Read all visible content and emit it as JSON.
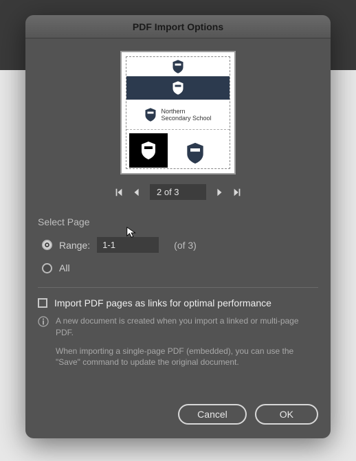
{
  "dialog": {
    "title": "PDF Import Options"
  },
  "preview": {
    "school_line1": "Northern",
    "school_line2": "Secondary School"
  },
  "pager": {
    "current": "2 of 3"
  },
  "select_page": {
    "label": "Select Page",
    "range_label": "Range:",
    "range_value": "1-1",
    "total_label": "(of 3)",
    "all_label": "All"
  },
  "import_links": {
    "checkbox_label": "Import PDF pages as links for optimal performance",
    "info_p1": "A new document is created when you import a linked or multi-page PDF.",
    "info_p2": "When importing a single-page PDF (embedded), you can use the \"Save\" command to update the original document."
  },
  "buttons": {
    "cancel": "Cancel",
    "ok": "OK"
  }
}
